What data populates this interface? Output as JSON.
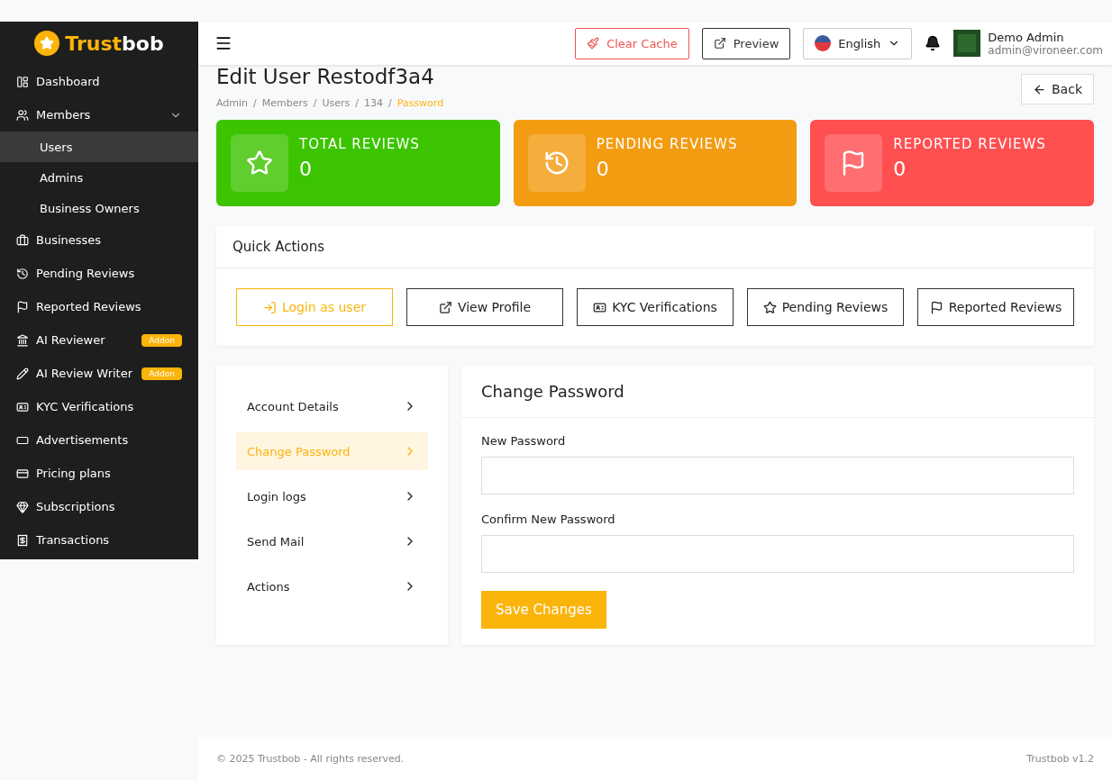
{
  "brand": {
    "part_1": "Trust",
    "part_2": "bob"
  },
  "sidebar": {
    "items": [
      {
        "label": "Dashboard",
        "selected": false
      },
      {
        "label": "Members",
        "selected": false,
        "expanded": true,
        "children": [
          {
            "label": "Users",
            "selected": true
          },
          {
            "label": "Admins",
            "selected": false
          },
          {
            "label": "Business Owners",
            "selected": false
          }
        ]
      },
      {
        "label": "Businesses",
        "selected": false
      },
      {
        "label": "Pending Reviews",
        "selected": false
      },
      {
        "label": "Reported Reviews",
        "selected": false
      },
      {
        "label": "AI Reviewer",
        "selected": false,
        "badge": "Addon"
      },
      {
        "label": "AI Review Writer",
        "selected": false,
        "badge": "Addon"
      },
      {
        "label": "KYC Verifications",
        "selected": false
      },
      {
        "label": "Advertisements",
        "selected": false
      },
      {
        "label": "Pricing plans",
        "selected": false
      },
      {
        "label": "Subscriptions",
        "selected": false
      },
      {
        "label": "Transactions",
        "selected": false
      }
    ]
  },
  "header": {
    "clear_cache": "Clear Cache",
    "preview": "Preview",
    "language": "English",
    "user_name": "Demo Admin",
    "user_email": "admin@vironeer.com"
  },
  "page": {
    "title": "Edit User Restodf3a4",
    "back": "Back",
    "breadcrumb_separator": "/",
    "breadcrumbs": [
      {
        "label": "Admin",
        "selected": false
      },
      {
        "label": "Members",
        "selected": false
      },
      {
        "label": "Users",
        "selected": false
      },
      {
        "label": "134",
        "selected": false
      },
      {
        "label": "Password",
        "selected": true
      }
    ]
  },
  "stats": [
    {
      "label": "TOTAL REVIEWS",
      "value": "0",
      "color": "#3cc400"
    },
    {
      "label": "PENDING REVIEWS",
      "value": "0",
      "color": "#f39c12"
    },
    {
      "label": "REPORTED REVIEWS",
      "value": "0",
      "color": "#ff4f51"
    }
  ],
  "quick_actions": {
    "title": "Quick Actions",
    "buttons": [
      {
        "label": "Login as user",
        "kind": "primary"
      },
      {
        "label": "View Profile",
        "kind": "outline"
      },
      {
        "label": "KYC Verifications",
        "kind": "outline"
      },
      {
        "label": "Pending Reviews",
        "kind": "outline"
      },
      {
        "label": "Reported Reviews",
        "kind": "outline"
      }
    ]
  },
  "tabs": [
    {
      "label": "Account Details",
      "selected": false
    },
    {
      "label": "Change Password",
      "selected": true
    },
    {
      "label": "Login logs",
      "selected": false
    },
    {
      "label": "Send Mail",
      "selected": false
    },
    {
      "label": "Actions",
      "selected": false
    }
  ],
  "form": {
    "title": "Change Password",
    "fields": [
      {
        "label": "New Password"
      },
      {
        "label": "Confirm New Password"
      }
    ],
    "submit": "Save Changes"
  },
  "footer": {
    "copyright": "© 2025 Trustbob - All rights reserved.",
    "version": "Trustbob v1.2"
  }
}
